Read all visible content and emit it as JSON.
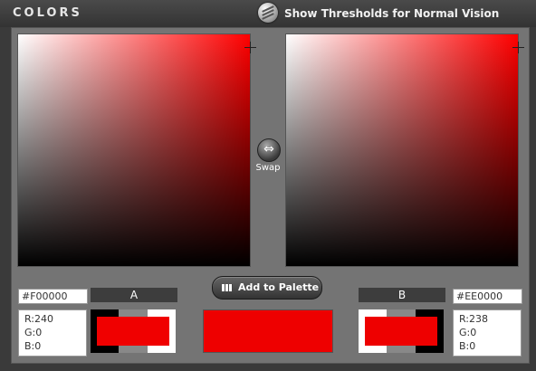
{
  "header": {
    "title": "COLORS",
    "thresholds_label": "Show Thresholds for Normal Vision",
    "thresholds_icon": "striped-globe-icon"
  },
  "pickers": [
    {
      "hue": "#FF0000"
    },
    {
      "hue": "#FF0000"
    }
  ],
  "swap": {
    "label": "Swap",
    "icon": "left-right-arrow-icon"
  },
  "add_to_palette": {
    "label": "Add to Palette",
    "icon": "grid-icon"
  },
  "color_a": {
    "label": "A",
    "hex": "#F00000",
    "r": "R:240",
    "g": "G:0",
    "b": "B:0",
    "value": "#F00000"
  },
  "color_b": {
    "label": "B",
    "hex": "#EE0000",
    "r": "R:238",
    "g": "G:0",
    "b": "B:0",
    "value": "#EE0000"
  },
  "blend": {
    "value": "#EE0000"
  }
}
